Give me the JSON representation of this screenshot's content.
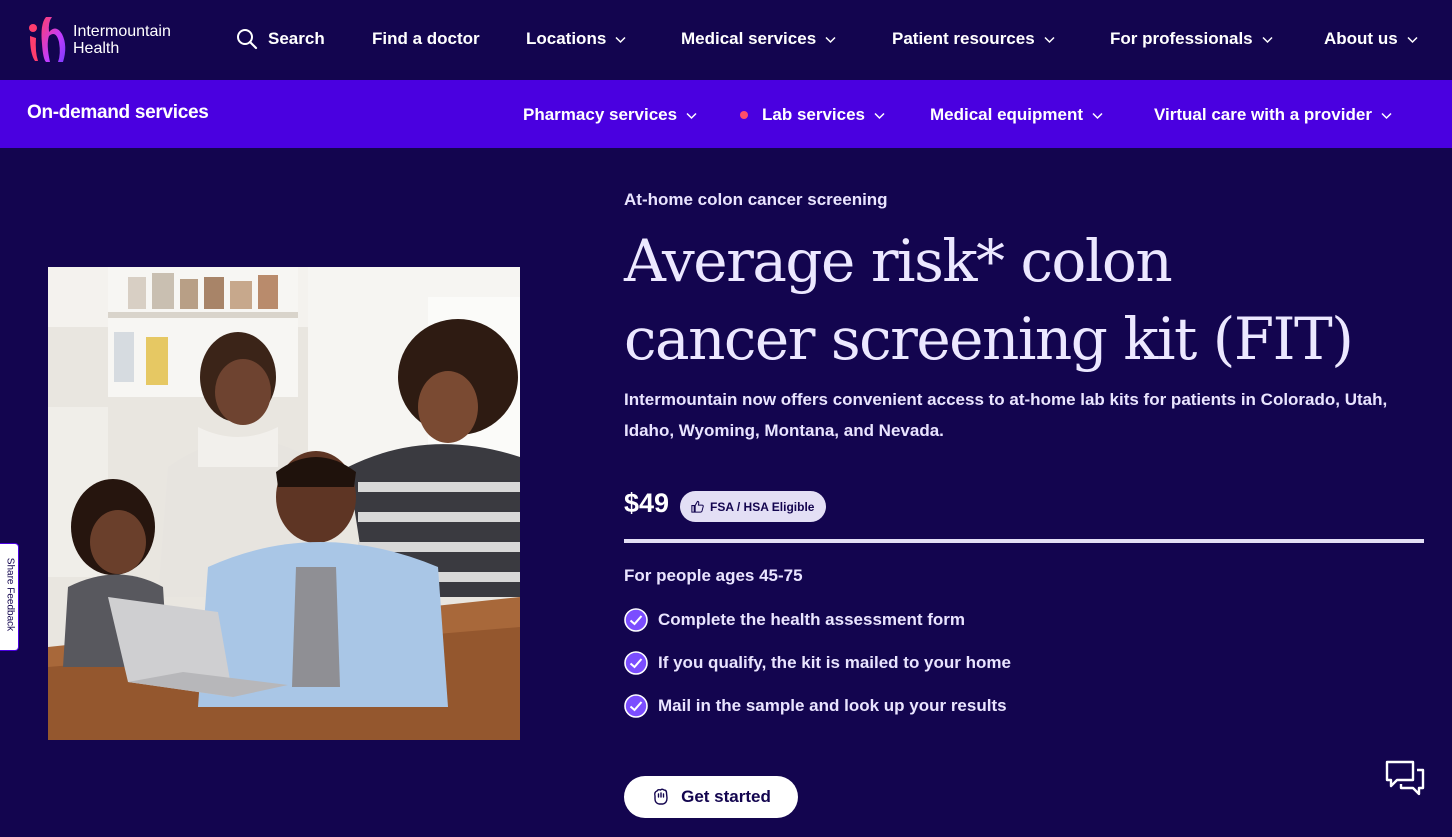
{
  "brand": {
    "name_line1": "Intermountain",
    "name_line2": "Health"
  },
  "topnav": {
    "search": "Search",
    "find_doctor": "Find a doctor",
    "locations": "Locations",
    "medical_services": "Medical services",
    "patient_resources": "Patient resources",
    "for_professionals": "For professionals",
    "about_us": "About us"
  },
  "subnav": {
    "title": "On-demand services",
    "pharmacy": "Pharmacy services",
    "lab": "Lab services",
    "equipment": "Medical equipment",
    "virtual_care": "Virtual care with a provider"
  },
  "feedback": {
    "label": "Share Feedback"
  },
  "product": {
    "eyebrow": "At-home colon cancer screening",
    "title_line1": "Average risk* colon",
    "title_line2": "cancer screening kit (FIT)",
    "description": "Intermountain now offers convenient access to at-home lab kits for patients in Colorado, Utah, Idaho, Wyoming, Montana, and Nevada.",
    "price": "$49",
    "badge": "FSA / HSA Eligible",
    "ages": "For people ages 45-75",
    "steps": [
      "Complete the health assessment form",
      "If you qualify, the kit is mailed to your home",
      "Mail in the sample and look up your results"
    ],
    "cta": "Get started"
  },
  "colors": {
    "background": "#13054f",
    "subnav": "#4a00e0",
    "accent_check": "#7b4dff",
    "active_dot": "#ff4d6a"
  },
  "icons": {
    "search": "search-icon",
    "chevron": "chevron-down-icon",
    "check": "check-circle-icon",
    "chat": "chat-icon",
    "thumb": "thumbs-up-icon",
    "cta": "hand-icon"
  }
}
